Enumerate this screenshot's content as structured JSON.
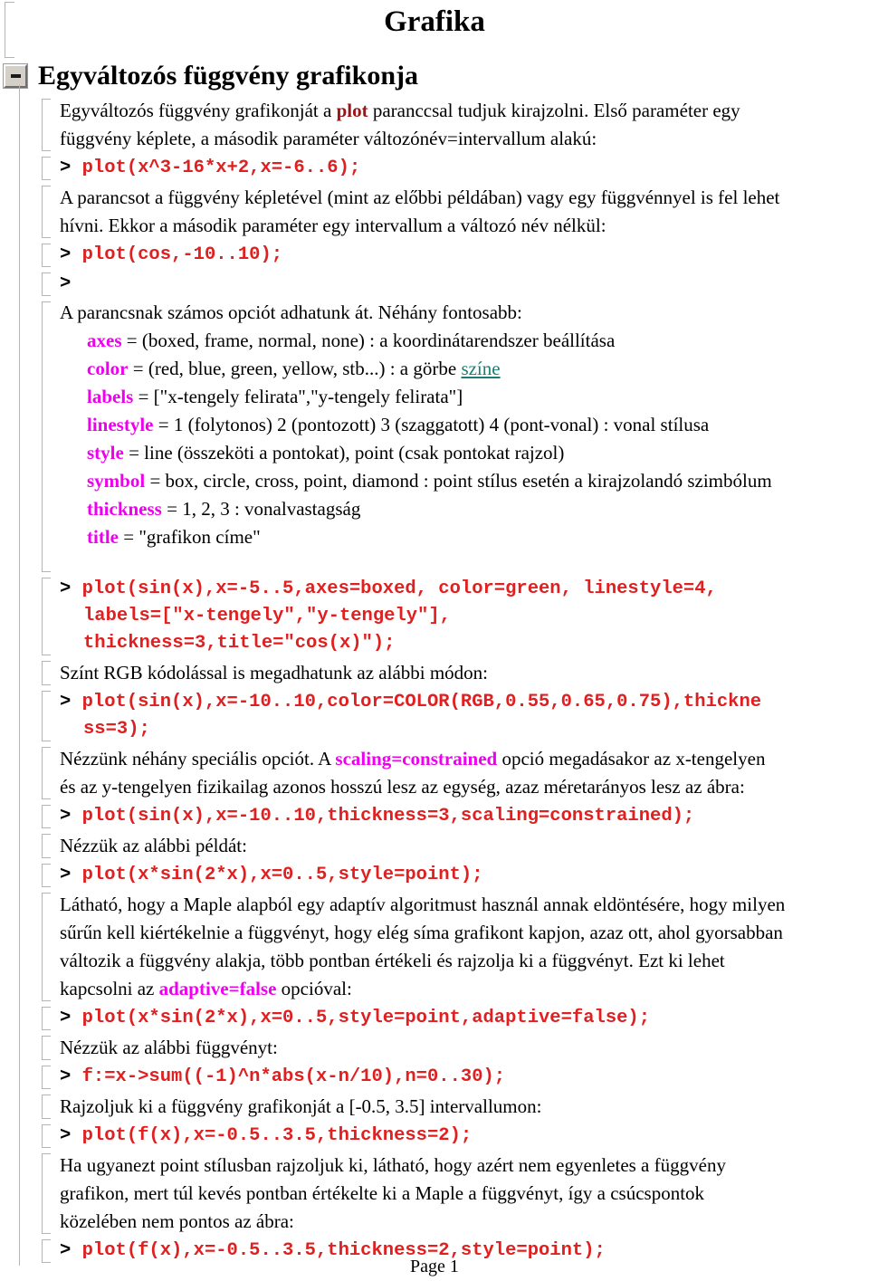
{
  "document": {
    "title": "Grafika",
    "footer": "Page 1"
  },
  "section": {
    "collapse_icon": "minus-icon",
    "heading": "Egyváltozós függvény grafikonja"
  },
  "blocks": [
    {
      "kind": "text",
      "lines": [
        {
          "parts": [
            {
              "t": "Egyváltozós függvény grafikonját a ",
              "style": "plain"
            },
            {
              "t": "plot",
              "style": "darkred"
            },
            {
              "t": " paranccsal tudjuk kirajzolni.  Első paraméter egy",
              "style": "plain"
            }
          ]
        },
        {
          "parts": [
            {
              "t": "függvény képlete, a második paraméter változónév=intervallum alakú:",
              "style": "plain"
            }
          ]
        }
      ]
    },
    {
      "kind": "code",
      "prompt": ">",
      "lines": [
        "plot(x^3-16*x+2,x=-6..6);"
      ]
    },
    {
      "kind": "text",
      "lines": [
        {
          "parts": [
            {
              "t": "A parancsot a függvény képletével (mint az előbbi példában) vagy egy függvénnyel is fel lehet",
              "style": "plain"
            }
          ]
        },
        {
          "parts": [
            {
              "t": "hívni. Ekkor a második paraméter egy intervallum a változó név nélkül:",
              "style": "plain"
            }
          ]
        }
      ]
    },
    {
      "kind": "code",
      "prompt": ">",
      "lines": [
        "plot(cos,-10..10);"
      ]
    },
    {
      "kind": "code",
      "prompt": ">",
      "lines": [
        ""
      ]
    },
    {
      "kind": "options",
      "intro": "A parancsnak számos opciót adhatunk át. Néhány fontosabb:",
      "rows": [
        {
          "name": "axes",
          "parts": [
            {
              "t": " =  (boxed, frame, normal, none)  : a koordinátarendszer beállítása",
              "style": "plain"
            }
          ]
        },
        {
          "name": "color",
          "parts": [
            {
              "t": " = (red, blue, green, yellow, stb...)  : a görbe ",
              "style": "plain"
            },
            {
              "t": "színe",
              "style": "link"
            }
          ]
        },
        {
          "name": "labels",
          "parts": [
            {
              "t": " = [\"x-tengely felirata\",\"y-tengely felirata\"]",
              "style": "plain"
            }
          ]
        },
        {
          "name": "linestyle",
          "parts": [
            {
              "t": " = 1 (folytonos)  2 (pontozott)  3 (szaggatott)  4 (pont-vonal) : vonal stílusa",
              "style": "plain"
            }
          ]
        },
        {
          "name": "style",
          "parts": [
            {
              "t": " = line (összeköti a pontokat), point (csak pontokat rajzol)",
              "style": "plain"
            }
          ]
        },
        {
          "name": "symbol",
          "parts": [
            {
              "t": " = box, circle, cross, point, diamond : point stílus esetén a kirajzolandó szimbólum",
              "style": "plain"
            }
          ]
        },
        {
          "name": "thickness",
          "parts": [
            {
              "t": " = 1, 2, 3   : vonalvastagság",
              "style": "plain"
            }
          ]
        },
        {
          "name": "title",
          "parts": [
            {
              "t": " = \"grafikon címe\"",
              "style": "plain"
            }
          ]
        }
      ]
    },
    {
      "kind": "code",
      "prompt": ">",
      "lines": [
        "plot(sin(x),x=-5..5,axes=boxed, color=green, linestyle=4,",
        "labels=[\"x-tengely\",\"y-tengely\"],",
        "thickness=3,title=\"cos(x)\");"
      ]
    },
    {
      "kind": "text",
      "lines": [
        {
          "parts": [
            {
              "t": "Színt RGB kódolással is megadhatunk az alábbi módon:",
              "style": "plain"
            }
          ]
        }
      ]
    },
    {
      "kind": "code",
      "prompt": ">",
      "lines": [
        "plot(sin(x),x=-10..10,color=COLOR(RGB,0.55,0.65,0.75),thickne",
        "ss=3);"
      ]
    },
    {
      "kind": "text",
      "lines": [
        {
          "parts": [
            {
              "t": "Nézzünk néhány speciális opciót.  A ",
              "style": "plain"
            },
            {
              "t": "scaling=constrained",
              "style": "magenta"
            },
            {
              "t": " opció megadásakor az x-tengelyen",
              "style": "plain"
            }
          ]
        },
        {
          "parts": [
            {
              "t": "és az y-tengelyen fizikailag azonos hosszú lesz az egység, azaz méretarányos lesz az ábra:",
              "style": "plain"
            }
          ]
        }
      ]
    },
    {
      "kind": "code",
      "prompt": ">",
      "lines": [
        "plot(sin(x),x=-10..10,thickness=3,scaling=constrained);"
      ]
    },
    {
      "kind": "text",
      "lines": [
        {
          "parts": [
            {
              "t": "Nézzük az alábbi példát:",
              "style": "plain"
            }
          ]
        }
      ]
    },
    {
      "kind": "code",
      "prompt": ">",
      "lines": [
        "plot(x*sin(2*x),x=0..5,style=point);"
      ]
    },
    {
      "kind": "text",
      "lines": [
        {
          "parts": [
            {
              "t": "Látható, hogy a Maple alapból egy adaptív algoritmust használ annak eldöntésére, hogy milyen",
              "style": "plain"
            }
          ]
        },
        {
          "parts": [
            {
              "t": "sűrűn kell kiértékelnie a függvényt, hogy elég síma grafikont kapjon, azaz ott, ahol gyorsabban",
              "style": "plain"
            }
          ]
        },
        {
          "parts": [
            {
              "t": "változik a függvény alakja, több pontban értékeli és rajzolja ki a függvényt. Ezt ki lehet",
              "style": "plain"
            }
          ]
        },
        {
          "parts": [
            {
              "t": "kapcsolni az ",
              "style": "plain"
            },
            {
              "t": "adaptive=false",
              "style": "magenta"
            },
            {
              "t": " opcióval:",
              "style": "plain"
            }
          ]
        }
      ]
    },
    {
      "kind": "code",
      "prompt": ">",
      "lines": [
        "plot(x*sin(2*x),x=0..5,style=point,adaptive=false);"
      ]
    },
    {
      "kind": "text",
      "lines": [
        {
          "parts": [
            {
              "t": "Nézzük az alábbi függvényt:",
              "style": "plain"
            }
          ]
        }
      ]
    },
    {
      "kind": "code",
      "prompt": ">",
      "lines": [
        "f:=x->sum((-1)^n*abs(x-n/10),n=0..30);"
      ]
    },
    {
      "kind": "text",
      "lines": [
        {
          "parts": [
            {
              "t": "Rajzoljuk ki a függvény grafikonját a [-0.5, 3.5] intervallumon:",
              "style": "plain"
            }
          ]
        }
      ]
    },
    {
      "kind": "code",
      "prompt": ">",
      "lines": [
        "plot(f(x),x=-0.5..3.5,thickness=2);"
      ]
    },
    {
      "kind": "text",
      "lines": [
        {
          "parts": [
            {
              "t": "Ha ugyanezt point stílusban rajzoljuk ki, látható, hogy azért nem egyenletes a függvény",
              "style": "plain"
            }
          ]
        },
        {
          "parts": [
            {
              "t": "grafikon, mert túl kevés pontban értékelte ki a Maple a függvényt, így a csúcspontok",
              "style": "plain"
            }
          ]
        },
        {
          "parts": [
            {
              "t": "közelében nem pontos az ábra:",
              "style": "plain"
            }
          ]
        }
      ]
    },
    {
      "kind": "code",
      "prompt": ">",
      "lines": [
        "plot(f(x),x=-0.5..3.5,thickness=2,style=point);"
      ]
    }
  ],
  "colors": {
    "code_red": "#e02020",
    "option_magenta": "#ee00ee",
    "keyword_darkred": "#9b1418",
    "hyperlink_teal": "#187f72",
    "bracket_gray": "#b4b4b4"
  }
}
